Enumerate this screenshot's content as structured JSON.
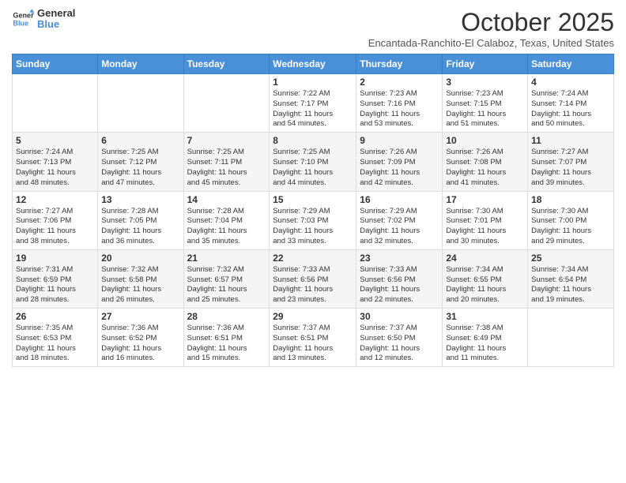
{
  "logo": {
    "line1": "General",
    "line2": "Blue"
  },
  "title": "October 2025",
  "location": "Encantada-Ranchito-El Calaboz, Texas, United States",
  "days_of_week": [
    "Sunday",
    "Monday",
    "Tuesday",
    "Wednesday",
    "Thursday",
    "Friday",
    "Saturday"
  ],
  "weeks": [
    [
      {
        "day": "",
        "content": ""
      },
      {
        "day": "",
        "content": ""
      },
      {
        "day": "",
        "content": ""
      },
      {
        "day": "1",
        "content": "Sunrise: 7:22 AM\nSunset: 7:17 PM\nDaylight: 11 hours and 54 minutes."
      },
      {
        "day": "2",
        "content": "Sunrise: 7:23 AM\nSunset: 7:16 PM\nDaylight: 11 hours and 53 minutes."
      },
      {
        "day": "3",
        "content": "Sunrise: 7:23 AM\nSunset: 7:15 PM\nDaylight: 11 hours and 51 minutes."
      },
      {
        "day": "4",
        "content": "Sunrise: 7:24 AM\nSunset: 7:14 PM\nDaylight: 11 hours and 50 minutes."
      }
    ],
    [
      {
        "day": "5",
        "content": "Sunrise: 7:24 AM\nSunset: 7:13 PM\nDaylight: 11 hours and 48 minutes."
      },
      {
        "day": "6",
        "content": "Sunrise: 7:25 AM\nSunset: 7:12 PM\nDaylight: 11 hours and 47 minutes."
      },
      {
        "day": "7",
        "content": "Sunrise: 7:25 AM\nSunset: 7:11 PM\nDaylight: 11 hours and 45 minutes."
      },
      {
        "day": "8",
        "content": "Sunrise: 7:25 AM\nSunset: 7:10 PM\nDaylight: 11 hours and 44 minutes."
      },
      {
        "day": "9",
        "content": "Sunrise: 7:26 AM\nSunset: 7:09 PM\nDaylight: 11 hours and 42 minutes."
      },
      {
        "day": "10",
        "content": "Sunrise: 7:26 AM\nSunset: 7:08 PM\nDaylight: 11 hours and 41 minutes."
      },
      {
        "day": "11",
        "content": "Sunrise: 7:27 AM\nSunset: 7:07 PM\nDaylight: 11 hours and 39 minutes."
      }
    ],
    [
      {
        "day": "12",
        "content": "Sunrise: 7:27 AM\nSunset: 7:06 PM\nDaylight: 11 hours and 38 minutes."
      },
      {
        "day": "13",
        "content": "Sunrise: 7:28 AM\nSunset: 7:05 PM\nDaylight: 11 hours and 36 minutes."
      },
      {
        "day": "14",
        "content": "Sunrise: 7:28 AM\nSunset: 7:04 PM\nDaylight: 11 hours and 35 minutes."
      },
      {
        "day": "15",
        "content": "Sunrise: 7:29 AM\nSunset: 7:03 PM\nDaylight: 11 hours and 33 minutes."
      },
      {
        "day": "16",
        "content": "Sunrise: 7:29 AM\nSunset: 7:02 PM\nDaylight: 11 hours and 32 minutes."
      },
      {
        "day": "17",
        "content": "Sunrise: 7:30 AM\nSunset: 7:01 PM\nDaylight: 11 hours and 30 minutes."
      },
      {
        "day": "18",
        "content": "Sunrise: 7:30 AM\nSunset: 7:00 PM\nDaylight: 11 hours and 29 minutes."
      }
    ],
    [
      {
        "day": "19",
        "content": "Sunrise: 7:31 AM\nSunset: 6:59 PM\nDaylight: 11 hours and 28 minutes."
      },
      {
        "day": "20",
        "content": "Sunrise: 7:32 AM\nSunset: 6:58 PM\nDaylight: 11 hours and 26 minutes."
      },
      {
        "day": "21",
        "content": "Sunrise: 7:32 AM\nSunset: 6:57 PM\nDaylight: 11 hours and 25 minutes."
      },
      {
        "day": "22",
        "content": "Sunrise: 7:33 AM\nSunset: 6:56 PM\nDaylight: 11 hours and 23 minutes."
      },
      {
        "day": "23",
        "content": "Sunrise: 7:33 AM\nSunset: 6:56 PM\nDaylight: 11 hours and 22 minutes."
      },
      {
        "day": "24",
        "content": "Sunrise: 7:34 AM\nSunset: 6:55 PM\nDaylight: 11 hours and 20 minutes."
      },
      {
        "day": "25",
        "content": "Sunrise: 7:34 AM\nSunset: 6:54 PM\nDaylight: 11 hours and 19 minutes."
      }
    ],
    [
      {
        "day": "26",
        "content": "Sunrise: 7:35 AM\nSunset: 6:53 PM\nDaylight: 11 hours and 18 minutes."
      },
      {
        "day": "27",
        "content": "Sunrise: 7:36 AM\nSunset: 6:52 PM\nDaylight: 11 hours and 16 minutes."
      },
      {
        "day": "28",
        "content": "Sunrise: 7:36 AM\nSunset: 6:51 PM\nDaylight: 11 hours and 15 minutes."
      },
      {
        "day": "29",
        "content": "Sunrise: 7:37 AM\nSunset: 6:51 PM\nDaylight: 11 hours and 13 minutes."
      },
      {
        "day": "30",
        "content": "Sunrise: 7:37 AM\nSunset: 6:50 PM\nDaylight: 11 hours and 12 minutes."
      },
      {
        "day": "31",
        "content": "Sunrise: 7:38 AM\nSunset: 6:49 PM\nDaylight: 11 hours and 11 minutes."
      },
      {
        "day": "",
        "content": ""
      }
    ]
  ]
}
